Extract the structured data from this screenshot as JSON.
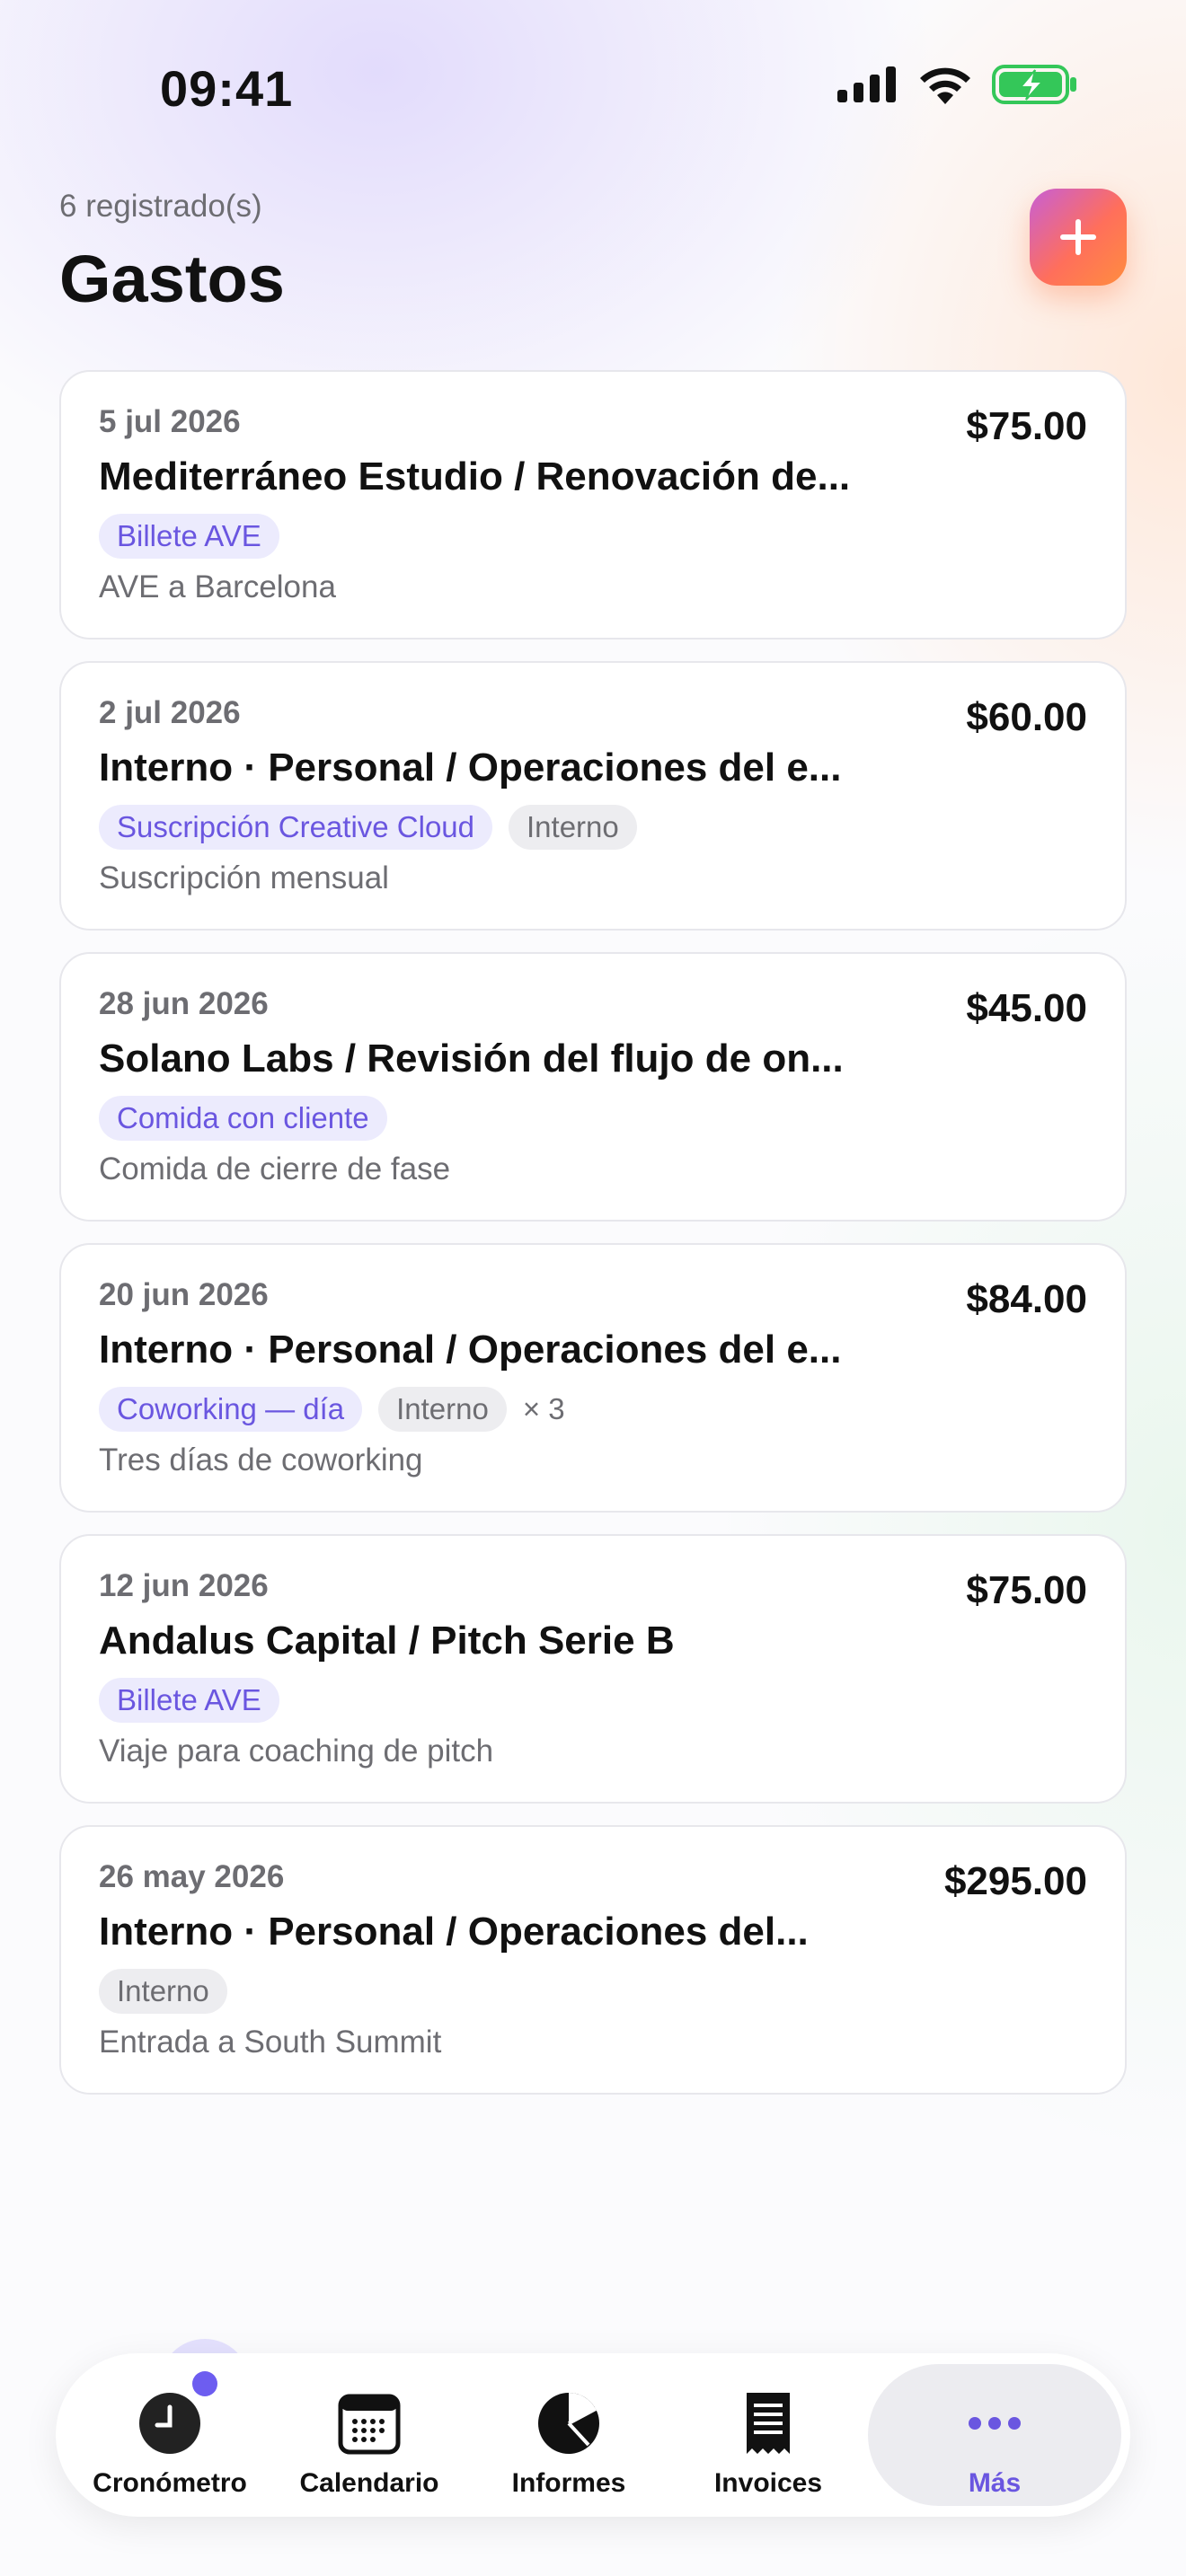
{
  "status": {
    "time": "09:41"
  },
  "header": {
    "count": "6 registrado(s)",
    "title": "Gastos",
    "add_icon": "plus-icon"
  },
  "expenses": [
    {
      "date": "5 jul 2026",
      "amount": "$75.00",
      "name": "Mediterráneo Estudio / Renovación de...",
      "tags": [
        "Billete AVE"
      ],
      "extra": "",
      "multiplier": "",
      "note": "AVE a Barcelona"
    },
    {
      "date": "2 jul 2026",
      "amount": "$60.00",
      "name": "Interno · Personal / Operaciones del e...",
      "tags": [
        "Suscripción Creative Cloud"
      ],
      "extra": "Interno",
      "multiplier": "",
      "note": "Suscripción mensual"
    },
    {
      "date": "28 jun 2026",
      "amount": "$45.00",
      "name": "Solano Labs / Revisión del flujo de on...",
      "tags": [
        "Comida con cliente"
      ],
      "extra": "",
      "multiplier": "",
      "note": "Comida de cierre de fase"
    },
    {
      "date": "20 jun 2026",
      "amount": "$84.00",
      "name": "Interno · Personal / Operaciones del e...",
      "tags": [
        "Coworking — día"
      ],
      "extra": "Interno",
      "multiplier": "× 3",
      "note": "Tres días de coworking"
    },
    {
      "date": "12 jun 2026",
      "amount": "$75.00",
      "name": "Andalus Capital / Pitch Serie B",
      "tags": [
        "Billete AVE"
      ],
      "extra": "",
      "multiplier": "",
      "note": "Viaje para coaching de pitch"
    },
    {
      "date": "26 may 2026",
      "amount": "$295.00",
      "name": "Interno · Personal / Operaciones del...",
      "tags": [],
      "extra": "Interno",
      "multiplier": "",
      "note": "Entrada a South Summit"
    }
  ],
  "tabs": [
    {
      "label": "Cronómetro",
      "icon": "stopwatch-icon"
    },
    {
      "label": "Calendario",
      "icon": "calendar-icon"
    },
    {
      "label": "Informes",
      "icon": "pie-chart-icon"
    },
    {
      "label": "Invoices",
      "icon": "receipt-icon"
    },
    {
      "label": "Más",
      "icon": "more-icon"
    }
  ],
  "colors": {
    "accent": "#6a56e0",
    "tag_bg": "#ecebfd",
    "neutral_tag_bg": "#ededf0",
    "battery": "#34c759"
  }
}
